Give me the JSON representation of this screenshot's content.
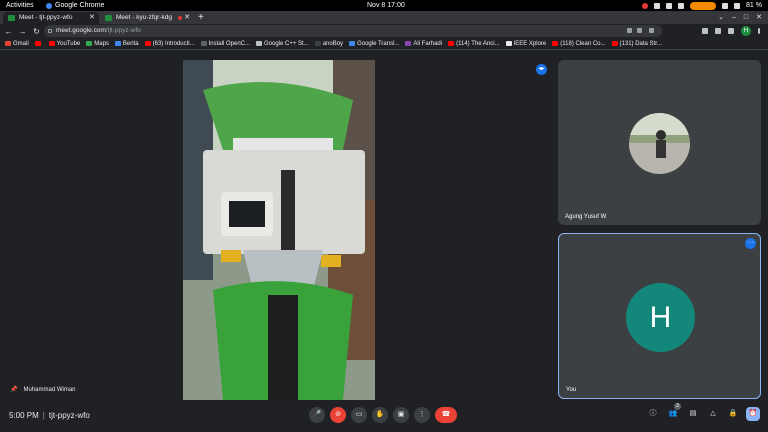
{
  "system": {
    "activities": "Activities",
    "app_name": "Google Chrome",
    "clock": "Nov 8  17:00",
    "battery": "81 %"
  },
  "tabs": [
    {
      "title": "Meet - tjt-ppyz-wfo",
      "active": true
    },
    {
      "title": "Meet - kyu-zfqr-kdg",
      "active": false
    }
  ],
  "toolbar": {
    "url_host": "meet.google.com",
    "url_path": "/tjt-ppyz-wfo",
    "profile_initial": "H"
  },
  "bookmarks": [
    {
      "label": "Gmail",
      "color": "#ea4335"
    },
    {
      "label": "",
      "color": "#ff0000"
    },
    {
      "label": "YouTube",
      "color": "#ff0000"
    },
    {
      "label": "Maps",
      "color": "#34a853"
    },
    {
      "label": "Berita",
      "color": "#4285f4"
    },
    {
      "label": "(63) Introducti...",
      "color": "#ff0000"
    },
    {
      "label": "Install OpenC...",
      "color": "#5f6368"
    },
    {
      "label": "Google C++ St...",
      "color": "#bdc1c6"
    },
    {
      "label": "anoBoy",
      "color": "#3c4043"
    },
    {
      "label": "Google Transl...",
      "color": "#4285f4"
    },
    {
      "label": "Ali Farhadi",
      "color": "#8e44ad"
    },
    {
      "label": "(114) The Anci...",
      "color": "#ff0000"
    },
    {
      "label": "IEEE Xplore",
      "color": "#e8eaed"
    },
    {
      "label": "(118) Clean Co...",
      "color": "#ff0000"
    },
    {
      "label": "(131) Data Str...",
      "color": "#ff0000"
    }
  ],
  "meeting": {
    "presenter_name": "Muhammad Wiman",
    "participants": [
      {
        "name": "Agung Yusuf W"
      },
      {
        "name": "You",
        "initial": "H",
        "color": "#12877a"
      }
    ],
    "time": "5:00 PM",
    "meeting_code": "tjt-ppyz-wfo",
    "participant_count": "3"
  }
}
